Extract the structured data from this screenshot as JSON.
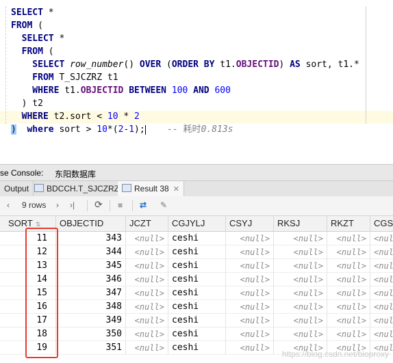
{
  "editor": {
    "lines": [
      [
        {
          "t": "SELECT",
          "c": "kw"
        },
        {
          "t": " *",
          "c": ""
        }
      ],
      [
        {
          "t": "FROM",
          "c": "kw"
        },
        {
          "t": " (",
          "c": ""
        }
      ],
      [
        {
          "t": "  SELECT",
          "c": "kw"
        },
        {
          "t": " *",
          "c": ""
        }
      ],
      [
        {
          "t": "  FROM",
          "c": "kw"
        },
        {
          "t": " (",
          "c": ""
        }
      ],
      [
        {
          "t": "    SELECT",
          "c": "kw"
        },
        {
          "t": " ",
          "c": ""
        },
        {
          "t": "row_number",
          "c": "fn"
        },
        {
          "t": "() ",
          "c": ""
        },
        {
          "t": "OVER",
          "c": "kw"
        },
        {
          "t": " (",
          "c": ""
        },
        {
          "t": "ORDER BY",
          "c": "kw"
        },
        {
          "t": " t1.",
          "c": ""
        },
        {
          "t": "OBJECTID",
          "c": "obj"
        },
        {
          "t": ") ",
          "c": ""
        },
        {
          "t": "AS",
          "c": "kw"
        },
        {
          "t": " sort, t1.*",
          "c": ""
        }
      ],
      [
        {
          "t": "    FROM",
          "c": "kw"
        },
        {
          "t": " T_SJCZRZ t1",
          "c": ""
        }
      ],
      [
        {
          "t": "    WHERE",
          "c": "kw"
        },
        {
          "t": " t1.",
          "c": ""
        },
        {
          "t": "OBJECTID",
          "c": "obj"
        },
        {
          "t": " ",
          "c": ""
        },
        {
          "t": "BETWEEN",
          "c": "kw"
        },
        {
          "t": " ",
          "c": ""
        },
        {
          "t": "100",
          "c": "num"
        },
        {
          "t": " ",
          "c": ""
        },
        {
          "t": "AND",
          "c": "kw"
        },
        {
          "t": " ",
          "c": ""
        },
        {
          "t": "600",
          "c": "num"
        }
      ],
      [
        {
          "t": "  ) t2",
          "c": ""
        }
      ],
      [
        {
          "t": "  WHERE",
          "c": "kw"
        },
        {
          "t": " t2.sort < ",
          "c": ""
        },
        {
          "t": "10",
          "c": "num"
        },
        {
          "t": " * ",
          "c": ""
        },
        {
          "t": "2",
          "c": "num"
        }
      ],
      [
        {
          "t": ")",
          "c": "paren-hl"
        },
        {
          "t": "  ",
          "c": ""
        },
        {
          "t": "where",
          "c": "kw"
        },
        {
          "t": " sort > ",
          "c": ""
        },
        {
          "t": "10",
          "c": "num"
        },
        {
          "t": "*(",
          "c": ""
        },
        {
          "t": "2",
          "c": "num"
        },
        {
          "t": "-",
          "c": ""
        },
        {
          "t": "1",
          "c": "num"
        },
        {
          "t": ");",
          "c": ""
        },
        {
          "t": "|caret",
          "c": "caret"
        },
        {
          "t": "    -- ",
          "c": "cm"
        },
        {
          "t": "耗时",
          "c": "cmcjk"
        },
        {
          "t": "0.813s",
          "c": "cm"
        }
      ]
    ]
  },
  "services": {
    "console_label": "se Console:",
    "db_label": "东阳数据库"
  },
  "tabs": [
    {
      "label": "Output",
      "active": false,
      "icon": false
    },
    {
      "label": "BDCCH.T_SJCZRZ",
      "active": false,
      "icon": true
    },
    {
      "label": "Result 38",
      "active": true,
      "icon": true
    }
  ],
  "toolbar": {
    "first_icon": "‹",
    "rows_label": "9 rows",
    "nav_icons": [
      "›",
      "›|"
    ],
    "refresh_icon": "⟳",
    "stop_icon": "■",
    "filter_icon": "⇄",
    "pin_icon": "📌"
  },
  "grid": {
    "columns": [
      "SORT",
      "OBJECTID",
      "JCZT",
      "CGJYLJ",
      "CSYJ",
      "RKSJ",
      "RKZT",
      "CGS"
    ],
    "null_text": "<null>",
    "rows": [
      [
        "11",
        "343",
        null,
        "ceshi",
        null,
        null,
        null,
        null
      ],
      [
        "12",
        "344",
        null,
        "ceshi",
        null,
        null,
        null,
        null
      ],
      [
        "13",
        "345",
        null,
        "ceshi",
        null,
        null,
        null,
        null
      ],
      [
        "14",
        "346",
        null,
        "ceshi",
        null,
        null,
        null,
        null
      ],
      [
        "15",
        "347",
        null,
        "ceshi",
        null,
        null,
        null,
        null
      ],
      [
        "16",
        "348",
        null,
        "ceshi",
        null,
        null,
        null,
        null
      ],
      [
        "17",
        "349",
        null,
        "ceshi",
        null,
        null,
        null,
        null
      ],
      [
        "18",
        "350",
        null,
        "ceshi",
        null,
        null,
        null,
        null
      ],
      [
        "19",
        "351",
        null,
        "ceshi",
        null,
        null,
        null,
        null
      ]
    ]
  },
  "watermark": "https://blog.csdn.net/bioproxy"
}
